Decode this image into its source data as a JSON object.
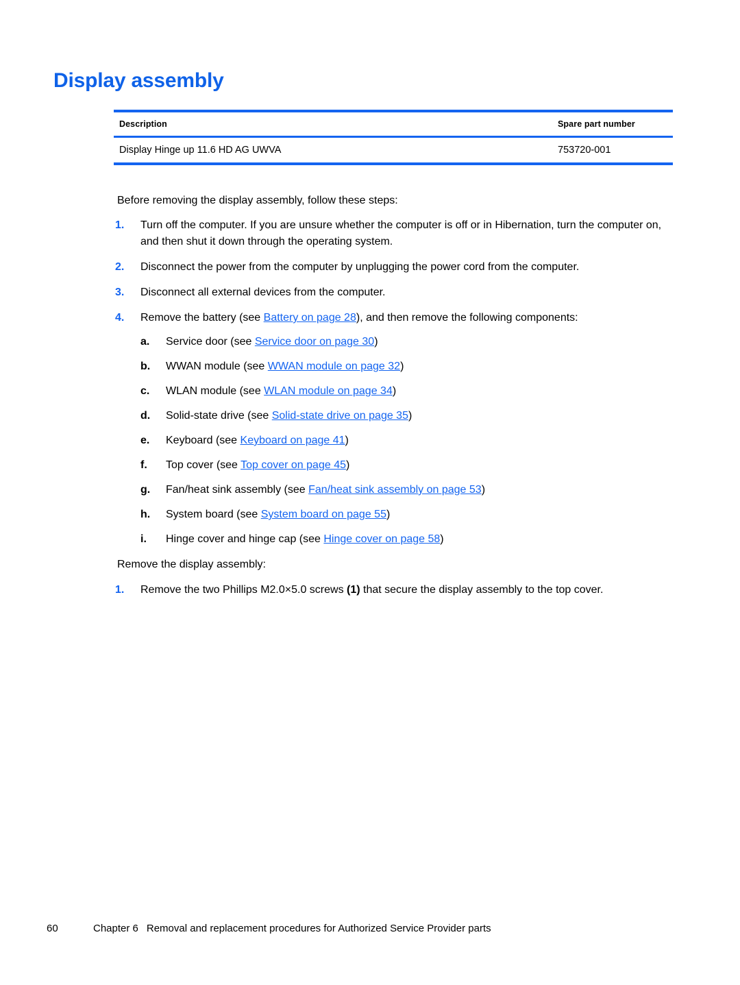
{
  "heading": "Display assembly",
  "table": {
    "columns": [
      "Description",
      "Spare part number"
    ],
    "rows": [
      {
        "description": "Display Hinge up 11.6 HD AG UWVA",
        "spare_part_number": "753720-001"
      }
    ]
  },
  "intro": "Before removing the display assembly, follow these steps:",
  "steps": [
    {
      "marker": "1.",
      "text": "Turn off the computer. If you are unsure whether the computer is off or in Hibernation, turn the computer on, and then shut it down through the operating system."
    },
    {
      "marker": "2.",
      "text": "Disconnect the power from the computer by unplugging the power cord from the computer."
    },
    {
      "marker": "3.",
      "text": "Disconnect all external devices from the computer."
    },
    {
      "marker": "4.",
      "prefix": "Remove the battery (see ",
      "link": "Battery on page 28",
      "suffix": "), and then remove the following components:"
    }
  ],
  "substeps": [
    {
      "marker": "a.",
      "prefix": "Service door (see ",
      "link": "Service door on page 30",
      "suffix": ")"
    },
    {
      "marker": "b.",
      "prefix": "WWAN module (see ",
      "link": "WWAN module on page 32",
      "suffix": ")"
    },
    {
      "marker": "c.",
      "prefix": "WLAN module (see ",
      "link": "WLAN module on page 34",
      "suffix": ")"
    },
    {
      "marker": "d.",
      "prefix": "Solid-state drive (see ",
      "link": "Solid-state drive on page 35",
      "suffix": ")"
    },
    {
      "marker": "e.",
      "prefix": "Keyboard (see ",
      "link": "Keyboard on page 41",
      "suffix": ")"
    },
    {
      "marker": "f.",
      "prefix": "Top cover (see ",
      "link": "Top cover on page 45",
      "suffix": ")"
    },
    {
      "marker": "g.",
      "prefix": "Fan/heat sink assembly (see ",
      "link": "Fan/heat sink assembly on page 53",
      "suffix": ")"
    },
    {
      "marker": "h.",
      "prefix": "System board (see ",
      "link": "System board on page 55",
      "suffix": ")"
    },
    {
      "marker": "i.",
      "prefix": "Hinge cover and hinge cap (see ",
      "link": "Hinge cover on page 58",
      "suffix": ")"
    }
  ],
  "remove_intro": "Remove the display assembly:",
  "remove_steps": [
    {
      "marker": "1.",
      "prefix": "Remove the two Phillips M2.0×5.0 screws ",
      "callout": "(1)",
      "suffix": " that secure the display assembly to the top cover."
    }
  ],
  "footer": {
    "page_number": "60",
    "chapter": "Chapter 6",
    "title": "Removal and replacement procedures for Authorized Service Provider parts"
  },
  "colors": {
    "accent_blue": "#1464F0",
    "heading_blue": "#0F62E8",
    "link_blue": "#1464F0",
    "text_black": "#000000",
    "background": "#ffffff"
  }
}
